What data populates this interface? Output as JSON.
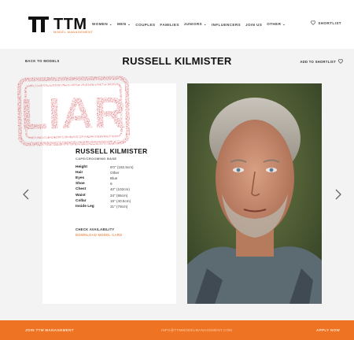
{
  "brand": {
    "logo_text": "TTM",
    "logo_sub": "MODEL MANAGEMENT"
  },
  "nav": {
    "items": [
      "WOMEN ⌄",
      "MEN ⌄",
      "COUPLES",
      "FAMILIES",
      "JUNIORS ⌄",
      "INFLUENCERS",
      "JOIN US",
      "OTHER ⌄"
    ],
    "shortlist": "SHORTLIST"
  },
  "page": {
    "back_link": "BACK TO MODELS",
    "title": "RUSSELL KILMISTER",
    "add_shortlist": "ADD TO SHORTLIST"
  },
  "card": {
    "name": "RUSSELL KILMISTER",
    "subtitle": "CAPE/CROOMING BASE",
    "stats": [
      {
        "label": "Height",
        "value": "6'0\" (182.5cm)"
      },
      {
        "label": "Hair",
        "value": "Other"
      },
      {
        "label": "Eyes",
        "value": "Blue"
      },
      {
        "label": "Shoe",
        "value": "9"
      },
      {
        "label": "Chest",
        "value": "40\" (102cm)"
      },
      {
        "label": "Waist",
        "value": "34\" (86cm)"
      },
      {
        "label": "Collar",
        "value": "16\" (40.5cm)"
      },
      {
        "label": "Inside Leg",
        "value": "31\" (79cm)"
      }
    ],
    "check_availability": "CHECK AVAILABILITY",
    "download_card": "DOWNLOAD MODEL CARD"
  },
  "stamp": {
    "text": "LIAR",
    "color": "#c8232c"
  },
  "footer": {
    "left": "JOIN TTM MANAGEMENT",
    "middle": "INFO@TTMMODELMANAGEMENT.COM",
    "right": "APPLY NOW"
  },
  "colors": {
    "accent": "#ee7322",
    "band": "#f3f3f3",
    "stamp": "#c8232c"
  }
}
